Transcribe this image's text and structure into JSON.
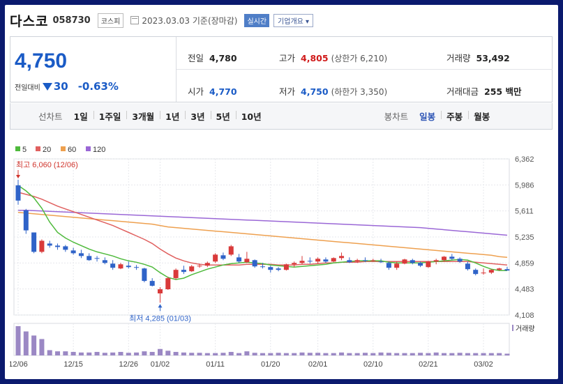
{
  "header": {
    "stock_name": "다스코",
    "stock_code": "058730",
    "market": "코스피",
    "date_text": "2023.03.03  기준(장마감)",
    "realtime_label": "실시간",
    "company_overview_label": "기업개요"
  },
  "summary": {
    "current_price": "4,750",
    "change_label": "전일대비",
    "change_amount": "30",
    "change_percent": "-0.63%",
    "prev_close_label": "전일",
    "prev_close": "4,780",
    "high_label": "고가",
    "high": "4,805",
    "upper_limit": "(상한가 6,210)",
    "volume_label": "거래량",
    "volume": "53,492",
    "open_label": "시가",
    "open": "4,770",
    "low_label": "저가",
    "low": "4,750",
    "lower_limit": "(하한가 3,350)",
    "turnover_label": "거래대금",
    "turnover": "255 백만"
  },
  "tabs": {
    "line_chart_label": "선차트",
    "line_periods": [
      "1일",
      "1주일",
      "3개월",
      "1년",
      "3년",
      "5년",
      "10년"
    ],
    "candle_chart_label": "봉차트",
    "candle_periods": [
      "일봉",
      "주봉",
      "월봉"
    ],
    "selected_candle": "일봉"
  },
  "colors": {
    "up": "#d93a3a",
    "down": "#2f63c8",
    "ma5": "#4fba3c",
    "ma20": "#e0605f",
    "ma60": "#eea04f",
    "ma120": "#9a67d6",
    "volume": "#9b88c4"
  },
  "chart_data": {
    "type": "candlestick",
    "legend": [
      {
        "name": "5",
        "color": "#4fba3c"
      },
      {
        "name": "20",
        "color": "#e0605f"
      },
      {
        "name": "60",
        "color": "#eea04f"
      },
      {
        "name": "120",
        "color": "#9a67d6"
      }
    ],
    "y_ticks": [
      "6,362",
      "5,986",
      "5,611",
      "5,235",
      "4,859",
      "4,483",
      "4,108"
    ],
    "ylim": [
      4108,
      6362
    ],
    "x_ticks": [
      {
        "label": "12/06",
        "index": 0
      },
      {
        "label": "12/15",
        "index": 7
      },
      {
        "label": "12/26",
        "index": 14
      },
      {
        "label": "01/02",
        "index": 18
      },
      {
        "label": "01/11",
        "index": 25
      },
      {
        "label": "01/20",
        "index": 32
      },
      {
        "label": "02/01",
        "index": 38
      },
      {
        "label": "02/10",
        "index": 45
      },
      {
        "label": "02/21",
        "index": 52
      },
      {
        "label": "03/02",
        "index": 59
      }
    ],
    "max_label": "최고 6,060 (12/06)",
    "min_label": "최저 4,285 (01/03)",
    "volume_label": "거래량",
    "candles": [
      [
        5980,
        6060,
        5700,
        5760
      ],
      [
        5620,
        5640,
        5280,
        5330
      ],
      [
        5300,
        5300,
        5000,
        5020
      ],
      [
        5020,
        5200,
        5000,
        5180
      ],
      [
        5140,
        5180,
        5080,
        5110
      ],
      [
        5110,
        5140,
        5050,
        5090
      ],
      [
        5100,
        5120,
        5020,
        5050
      ],
      [
        5040,
        5080,
        4980,
        5000
      ],
      [
        5000,
        5050,
        4930,
        4960
      ],
      [
        4960,
        5000,
        4890,
        4900
      ],
      [
        4930,
        4960,
        4880,
        4920
      ],
      [
        4900,
        4940,
        4840,
        4860
      ],
      [
        4850,
        4900,
        4760,
        4790
      ],
      [
        4780,
        4860,
        4770,
        4840
      ],
      [
        4820,
        4880,
        4780,
        4800
      ],
      [
        4800,
        4830,
        4760,
        4790
      ],
      [
        4780,
        4790,
        4580,
        4600
      ],
      [
        4600,
        4640,
        4520,
        4530
      ],
      [
        4420,
        4510,
        4285,
        4480
      ],
      [
        4480,
        4660,
        4470,
        4640
      ],
      [
        4640,
        4780,
        4620,
        4760
      ],
      [
        4760,
        4820,
        4700,
        4730
      ],
      [
        4740,
        4830,
        4730,
        4810
      ],
      [
        4810,
        4850,
        4790,
        4820
      ],
      [
        4820,
        4880,
        4800,
        4860
      ],
      [
        4880,
        5000,
        4860,
        4980
      ],
      [
        4970,
        5010,
        4900,
        4920
      ],
      [
        4980,
        5120,
        4960,
        5100
      ],
      [
        4940,
        4990,
        4860,
        4880
      ],
      [
        4870,
        5020,
        4860,
        4920
      ],
      [
        4900,
        4910,
        4790,
        4810
      ],
      [
        4810,
        4860,
        4780,
        4800
      ],
      [
        4800,
        4820,
        4720,
        4760
      ],
      [
        4780,
        4800,
        4740,
        4760
      ],
      [
        4760,
        4850,
        4750,
        4840
      ],
      [
        4840,
        4880,
        4800,
        4860
      ],
      [
        4860,
        4960,
        4840,
        4890
      ],
      [
        4890,
        4940,
        4850,
        4880
      ],
      [
        4880,
        4940,
        4850,
        4920
      ],
      [
        4910,
        4940,
        4860,
        4880
      ],
      [
        4880,
        4940,
        4870,
        4930
      ],
      [
        4930,
        5010,
        4900,
        4960
      ],
      [
        4900,
        4940,
        4860,
        4870
      ],
      [
        4880,
        4920,
        4860,
        4900
      ],
      [
        4900,
        4940,
        4870,
        4890
      ],
      [
        4900,
        4920,
        4880,
        4900
      ],
      [
        4880,
        4920,
        4860,
        4870
      ],
      [
        4860,
        4880,
        4760,
        4790
      ],
      [
        4790,
        4880,
        4760,
        4850
      ],
      [
        4850,
        4920,
        4840,
        4910
      ],
      [
        4900,
        4920,
        4840,
        4860
      ],
      [
        4860,
        4880,
        4800,
        4820
      ],
      [
        4800,
        4890,
        4790,
        4880
      ],
      [
        4880,
        4920,
        4840,
        4900
      ],
      [
        4900,
        4960,
        4880,
        4950
      ],
      [
        4950,
        4990,
        4900,
        4920
      ],
      [
        4920,
        4940,
        4860,
        4880
      ],
      [
        4850,
        4880,
        4750,
        4770
      ],
      [
        4760,
        4780,
        4680,
        4700
      ],
      [
        4710,
        4780,
        4690,
        4720
      ],
      [
        4720,
        4770,
        4700,
        4760
      ],
      [
        4760,
        4790,
        4750,
        4780
      ],
      [
        4770,
        4805,
        4750,
        4750
      ]
    ],
    "volumes": [
      100,
      82,
      68,
      56,
      18,
      14,
      14,
      12,
      10,
      10,
      12,
      9,
      10,
      12,
      9,
      10,
      14,
      12,
      22,
      16,
      12,
      10,
      9,
      9,
      8,
      8,
      9,
      12,
      8,
      14,
      9,
      8,
      8,
      9,
      8,
      8,
      10,
      9,
      9,
      8,
      8,
      10,
      8,
      8,
      9,
      8,
      10,
      9,
      8,
      8,
      8,
      9,
      8,
      10,
      8,
      8,
      9,
      8,
      8,
      8,
      8,
      8,
      6
    ],
    "ma5": [
      5980,
      5900,
      5800,
      5650,
      5450,
      5300,
      5220,
      5160,
      5110,
      5060,
      5020,
      4990,
      4960,
      4920,
      4890,
      4870,
      4840,
      4800,
      4720,
      4650,
      4620,
      4640,
      4690,
      4730,
      4770,
      4800,
      4830,
      4850,
      4860,
      4870,
      4860,
      4850,
      4830,
      4820,
      4810,
      4800,
      4810,
      4820,
      4830,
      4840,
      4860,
      4870,
      4880,
      4890,
      4890,
      4890,
      4890,
      4870,
      4860,
      4860,
      4860,
      4860,
      4870,
      4880,
      4890,
      4900,
      4910,
      4900,
      4860,
      4810,
      4770,
      4750,
      4750
    ],
    "ma20": [
      5880,
      5850,
      5820,
      5780,
      5730,
      5680,
      5640,
      5600,
      5560,
      5520,
      5480,
      5440,
      5400,
      5350,
      5300,
      5250,
      5200,
      5140,
      5060,
      4990,
      4930,
      4890,
      4860,
      4840,
      4830,
      4830,
      4830,
      4830,
      4830,
      4840,
      4840,
      4840,
      4840,
      4830,
      4830,
      4830,
      4840,
      4840,
      4850,
      4860,
      4860,
      4870,
      4870,
      4870,
      4880,
      4880,
      4880,
      4880,
      4880,
      4880,
      4880,
      4880,
      4880,
      4880,
      4880,
      4880,
      4880,
      4880,
      4870,
      4860,
      4850,
      4840,
      4830
    ],
    "ma60": [
      5590,
      5580,
      5570,
      5560,
      5550,
      5540,
      5530,
      5520,
      5510,
      5500,
      5490,
      5480,
      5470,
      5460,
      5450,
      5440,
      5430,
      5420,
      5400,
      5380,
      5370,
      5360,
      5350,
      5340,
      5330,
      5320,
      5310,
      5300,
      5290,
      5280,
      5270,
      5260,
      5250,
      5240,
      5230,
      5220,
      5210,
      5200,
      5190,
      5180,
      5170,
      5160,
      5150,
      5140,
      5130,
      5120,
      5110,
      5100,
      5090,
      5080,
      5070,
      5060,
      5050,
      5040,
      5030,
      5020,
      5010,
      5000,
      4990,
      4980,
      4970,
      4950,
      4940
    ],
    "ma120": [
      5620,
      5620,
      5615,
      5610,
      5605,
      5600,
      5595,
      5590,
      5585,
      5580,
      5575,
      5570,
      5565,
      5560,
      5555,
      5550,
      5545,
      5540,
      5535,
      5530,
      5525,
      5520,
      5515,
      5510,
      5505,
      5500,
      5495,
      5490,
      5485,
      5480,
      5475,
      5470,
      5465,
      5460,
      5455,
      5450,
      5445,
      5440,
      5435,
      5430,
      5425,
      5420,
      5415,
      5410,
      5405,
      5400,
      5395,
      5390,
      5385,
      5380,
      5375,
      5370,
      5360,
      5350,
      5340,
      5330,
      5320,
      5310,
      5300,
      5290,
      5280,
      5270,
      5260
    ]
  }
}
